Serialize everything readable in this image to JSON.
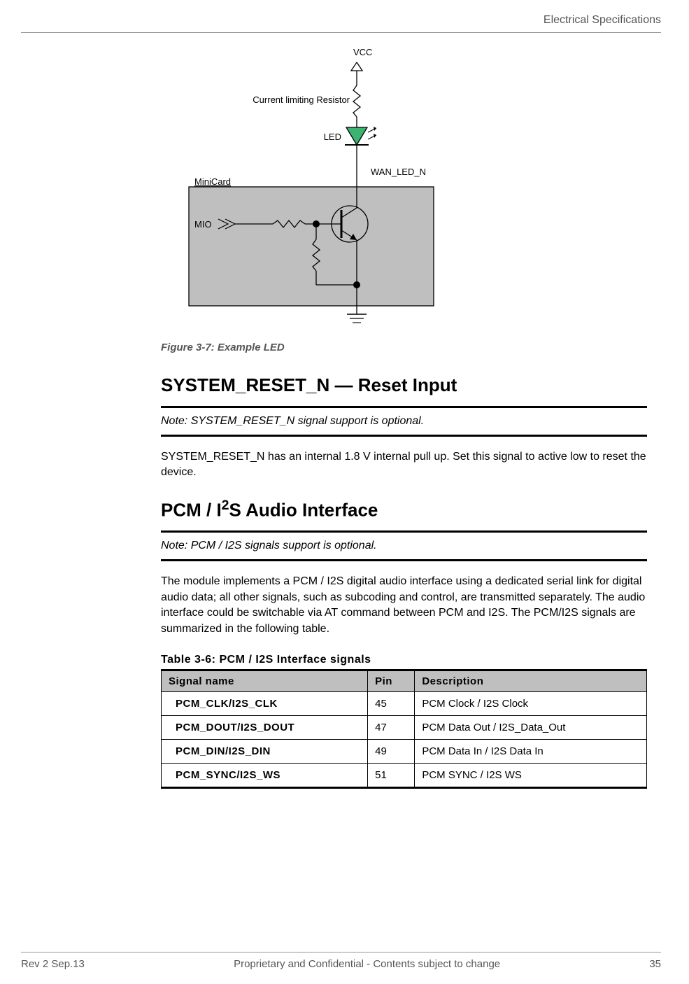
{
  "header": {
    "section_title": "Electrical Specifications"
  },
  "diagram": {
    "vcc_label": "VCC",
    "resistor_label": "Current limiting Resistor",
    "led_label": "LED",
    "wan_label": "WAN_LED_N",
    "minicard_label": "MiniCard",
    "mio_label": "MIO"
  },
  "figure_caption": "Figure 3-7:  Example LED",
  "section1": {
    "heading": "SYSTEM_RESET_N — Reset Input",
    "note": "Note:  SYSTEM_RESET_N signal support is optional.",
    "body": "SYSTEM_RESET_N has an internal 1.8 V internal pull up. Set this signal to active low to reset the device."
  },
  "section2": {
    "heading_pre": "PCM / I",
    "heading_sup": "2",
    "heading_post": "S Audio Interface",
    "note": "Note:  PCM / I2S signals support is optional.",
    "body": "The module implements a PCM / I2S digital audio interface using a dedicated serial link for digital audio data; all other signals, such as subcoding and control, are transmitted separately. The audio interface could be switchable via AT command between PCM and I2S. The PCM/I2S signals are summarized in the following table."
  },
  "table": {
    "title": "Table 3-6:  PCM / I2S Interface signals",
    "headers": {
      "c0": "Signal name",
      "c1": "Pin",
      "c2": "Description"
    },
    "rows": [
      {
        "name": "PCM_CLK/I2S_CLK",
        "pin": "45",
        "desc": "PCM Clock / I2S Clock"
      },
      {
        "name": "PCM_DOUT/I2S_DOUT",
        "pin": "47",
        "desc": "PCM Data Out / I2S_Data_Out"
      },
      {
        "name": "PCM_DIN/I2S_DIN",
        "pin": "49",
        "desc": "PCM Data In / I2S Data In"
      },
      {
        "name": "PCM_SYNC/I2S_WS",
        "pin": "51",
        "desc": "PCM SYNC / I2S WS"
      }
    ]
  },
  "footer": {
    "left": "Rev 2  Sep.13",
    "center": "Proprietary and Confidential - Contents subject to change",
    "right": "35"
  }
}
